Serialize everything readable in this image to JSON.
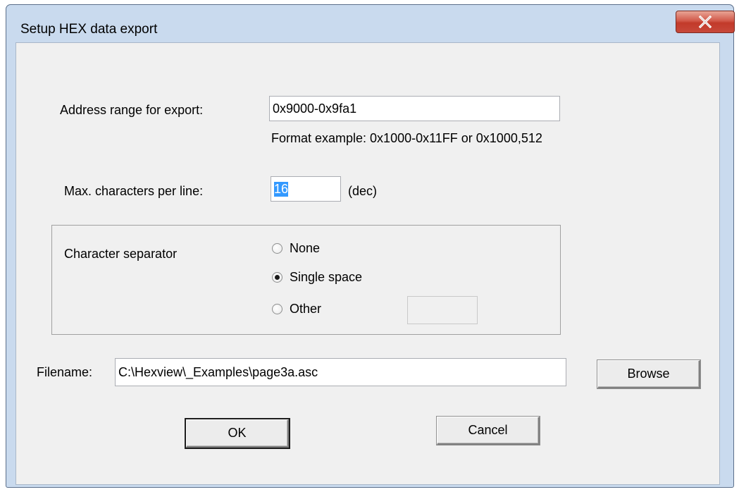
{
  "dialog": {
    "title": "Setup HEX data export",
    "close_glyph": "X"
  },
  "address": {
    "label": "Address range for export:",
    "value": "0x9000-0x9fa1",
    "hint": "Format example: 0x1000-0x11FF or 0x1000,512"
  },
  "max_chars": {
    "label": "Max. characters per line:",
    "value": "16",
    "unit": "(dec)"
  },
  "separator": {
    "label": "Character separator",
    "options": [
      {
        "label": "None",
        "selected": false
      },
      {
        "label": "Single space",
        "selected": true
      },
      {
        "label": "Other",
        "selected": false
      }
    ],
    "other_value": ""
  },
  "filename": {
    "label": "Filename:",
    "value": "C:\\Hexview\\_Examples\\page3a.asc",
    "browse_label": "Browse"
  },
  "buttons": {
    "ok_label": "OK",
    "cancel_label": "Cancel"
  }
}
